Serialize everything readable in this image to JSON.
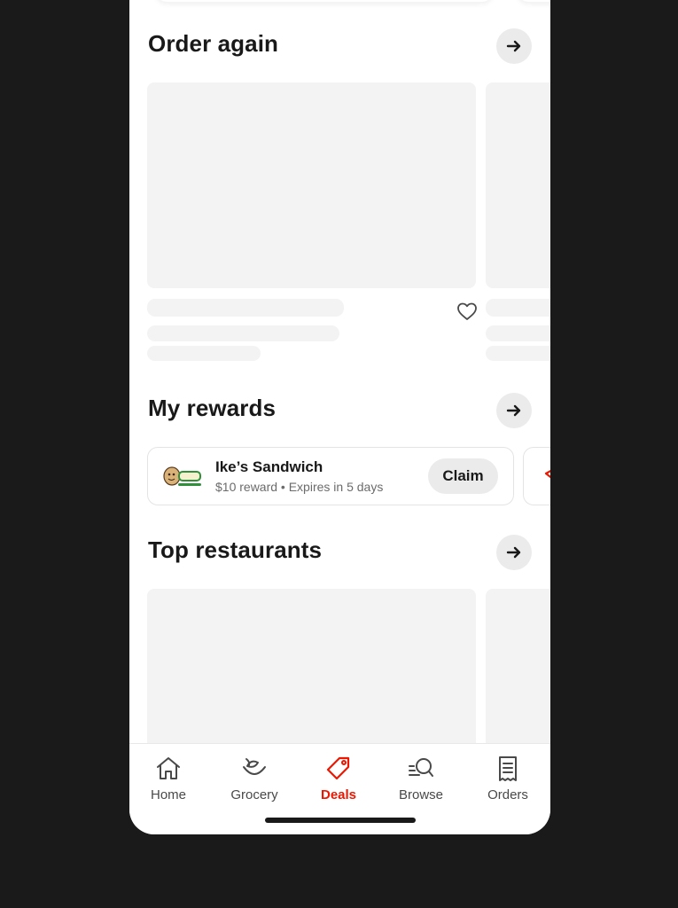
{
  "sections": {
    "order_again": {
      "title": "Order again"
    },
    "my_rewards": {
      "title": "My rewards"
    },
    "top_restaurants": {
      "title": "Top restaurants"
    }
  },
  "reward": {
    "name": "Ike’s Sandwich",
    "subtitle": "$10 reward • Expires in 5 days",
    "claim_label": "Claim",
    "logo_icon": "ikes-logo-icon"
  },
  "tabs": [
    {
      "label": "Home",
      "icon": "home-icon",
      "active": false
    },
    {
      "label": "Grocery",
      "icon": "grocery-icon",
      "active": false
    },
    {
      "label": "Deals",
      "icon": "deals-tag-icon",
      "active": true
    },
    {
      "label": "Browse",
      "icon": "browse-search-icon",
      "active": false
    },
    {
      "label": "Orders",
      "icon": "orders-receipt-icon",
      "active": false
    }
  ],
  "colors": {
    "accent": "#eb1700",
    "skeleton": "#f3f3f3",
    "button_bg": "#ebebeb",
    "text_primary": "#191919",
    "text_secondary": "#6b6b6b",
    "backdrop": "#1b1a1a"
  }
}
